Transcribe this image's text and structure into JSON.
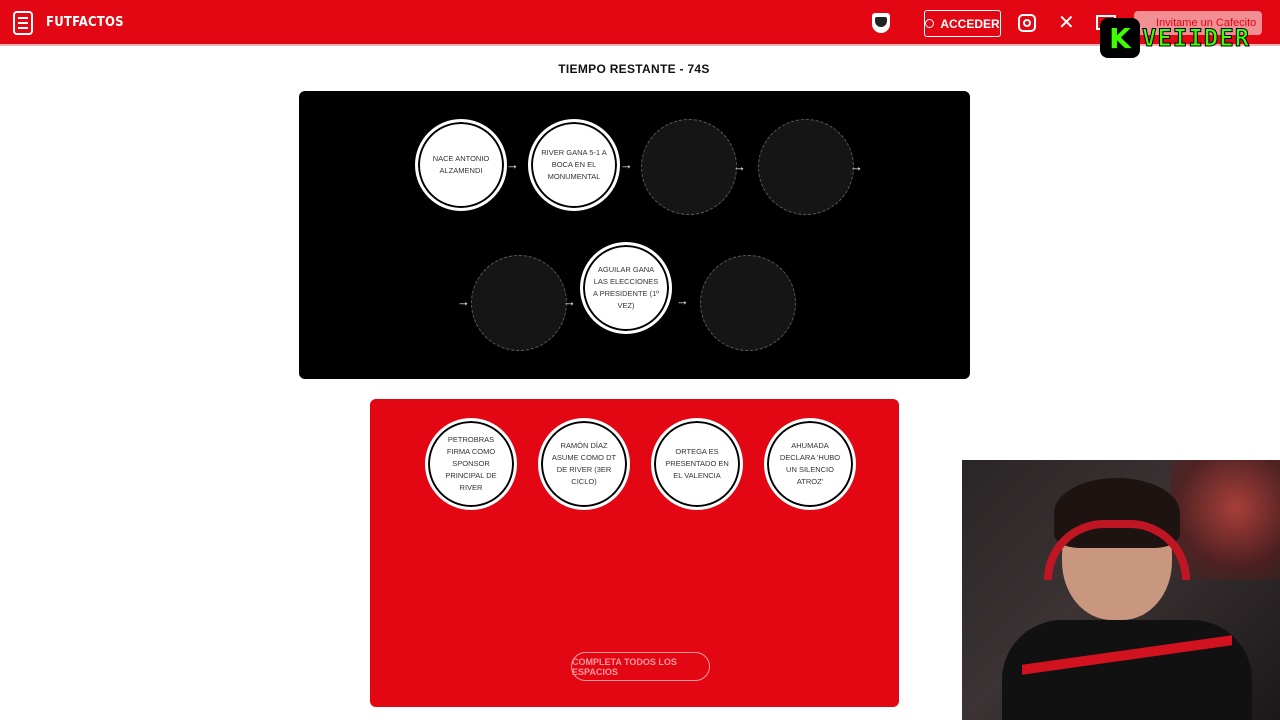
{
  "header": {
    "brand": "FUTFACTOS",
    "login_label": "ACCEDER",
    "cafecito_label": "Invitame un Cafecito"
  },
  "overlay": {
    "badge": "K",
    "streamer": "VEIIDER"
  },
  "timer": "TIEMPO RESTANTE - 74S",
  "timeline": {
    "row1": [
      {
        "text": "NACE ANTONIO ALZAMENDI",
        "state": "filled"
      },
      {
        "text": "RIVER GANA 5-1 A BOCA EN EL MONUMENTAL",
        "state": "filled"
      },
      {
        "text": "",
        "state": "empty"
      },
      {
        "text": "",
        "state": "empty"
      }
    ],
    "row2": [
      {
        "text": "",
        "state": "empty"
      },
      {
        "text": "AGUILAR GANA LAS ELECCIONES A PRESIDENTE (1º VEZ)",
        "state": "filled"
      },
      {
        "text": "",
        "state": "empty"
      }
    ]
  },
  "options": {
    "cards": [
      "PETROBRAS FIRMA COMO SPONSOR PRINCIPAL DE RIVER",
      "RAMÓN DÍAZ ASUME COMO DT DE RIVER (3ER CICLO)",
      "ORTEGA ES PRESENTADO EN EL VALENCIA",
      "AHUMADA DECLARA 'HUBO UN SILENCIO ATROZ'"
    ],
    "complete_label": "COMPLETA TODOS LOS ESPACIOS"
  },
  "colors": {
    "brand_red": "#e30613",
    "board_black": "#000000"
  }
}
